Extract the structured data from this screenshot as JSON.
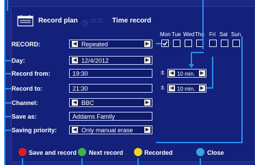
{
  "header": {
    "tab_record_plan": "Record plan",
    "clock": "18:25",
    "tab_time_record": "Time record"
  },
  "days": [
    "Mon",
    "Tue",
    "Wed",
    "Thu",
    "Fri",
    "Sat",
    "Sun"
  ],
  "form": {
    "record_label": "RECORD:",
    "record_value": "Repeated",
    "day_label": "Day:",
    "day_value": "12/4/2012",
    "record_from_label": "Record from:",
    "record_from_value": "19:30",
    "record_to_label": "Record to:",
    "record_to_value": "21:30",
    "channel_label": "Channel:",
    "channel_value": "BBC",
    "save_as_label": "Save as:",
    "save_as_value": "Addams Family",
    "saving_priority_label": "Saving priority:",
    "saving_priority_value": "Only manual erase",
    "pm_symbol": "±",
    "pad_from": "10 min.",
    "pad_to": "10 min."
  },
  "footer": {
    "save_and_record": "Save and record",
    "next_record": "Next record",
    "recorded": "Recorded",
    "close": "Close"
  },
  "colors": {
    "panel": "#1b2a86",
    "callout": "#2a8cf0",
    "red": "#e31b23",
    "green": "#3db34a",
    "yellow": "#f2d31c",
    "blue": "#3aa3e8"
  }
}
